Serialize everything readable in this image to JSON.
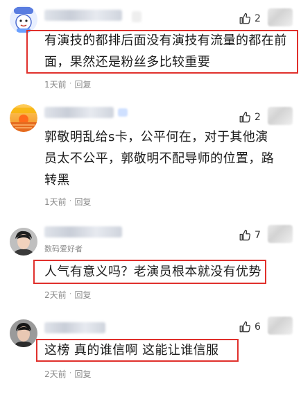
{
  "comments": [
    {
      "likes": "2",
      "text": "有演技的都排后面没有演技有流量的都在前面，果然还是粉丝多比较重要",
      "time": "1天前",
      "reply": "回复",
      "dot": "·",
      "avatar_icon": "cartoon-avatar-icon",
      "highlighted": true
    },
    {
      "likes": "2",
      "text": "郭敬明乱给s卡，公平何在，对于其他演员太不公平，郭敬明不配导师的位置，路转黑",
      "time": "1天前",
      "reply": "回复",
      "dot": "·",
      "avatar_icon": "sunset-avatar-icon",
      "highlighted": false
    },
    {
      "likes": "7",
      "badge": "数码爱好者",
      "text": "人气有意义吗？老演员根本就没有优势",
      "time": "2天前",
      "reply": "回复",
      "dot": "·",
      "avatar_icon": "portrait-avatar-icon",
      "highlighted": true
    },
    {
      "likes": "6",
      "text": "这榜 真的谁信啊 这能让谁信服",
      "time": "2天前",
      "reply": "回复",
      "dot": "·",
      "avatar_icon": "portrait-avatar-icon",
      "highlighted": true
    }
  ],
  "colors": {
    "highlight_border": "#e0302c",
    "meta_text": "#8a8a8a"
  }
}
